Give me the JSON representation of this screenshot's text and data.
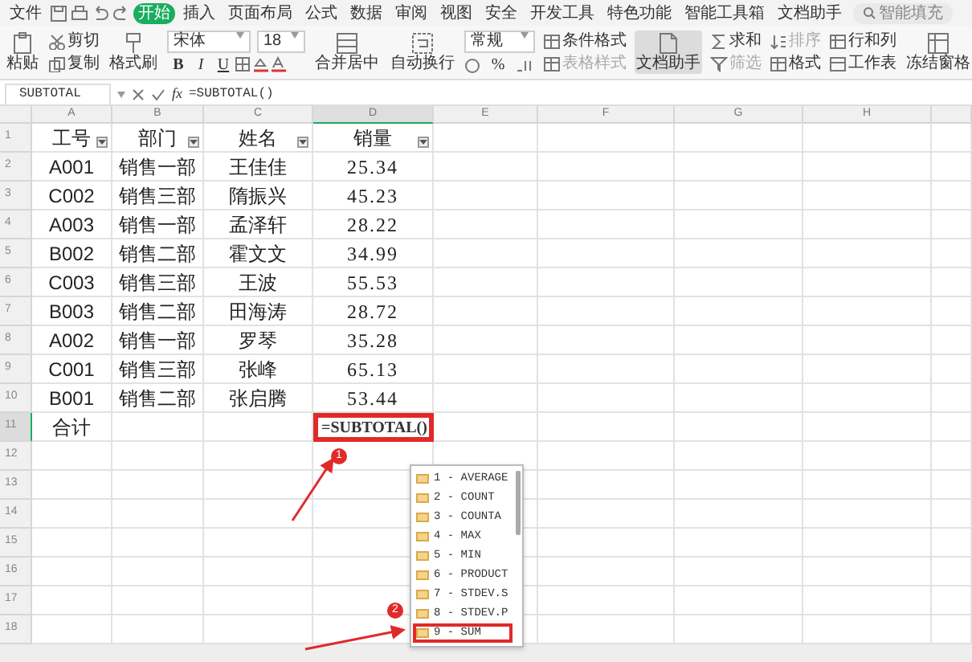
{
  "menu_bar": {
    "file_label": "文件",
    "tabs": [
      {
        "label": "开始",
        "selected": true
      },
      {
        "label": "插入",
        "selected": false
      },
      {
        "label": "页面布局",
        "selected": false
      },
      {
        "label": "公式",
        "selected": false
      },
      {
        "label": "数据",
        "selected": false
      },
      {
        "label": "审阅",
        "selected": false
      },
      {
        "label": "视图",
        "selected": false
      },
      {
        "label": "安全",
        "selected": false
      },
      {
        "label": "开发工具",
        "selected": false
      },
      {
        "label": "特色功能",
        "selected": false
      },
      {
        "label": "智能工具箱",
        "selected": false
      },
      {
        "label": "文档助手",
        "selected": false
      }
    ],
    "search": {
      "placeholder": "智能填充"
    }
  },
  "ribbon": {
    "groups": [
      {
        "kind": "large",
        "items": [
          {
            "label": "粘贴",
            "disabled": false,
            "pressed": false
          }
        ]
      },
      {
        "kind": "stack",
        "items": [
          {
            "label": "剪切",
            "disabled": false,
            "pressed": false
          },
          {
            "label": "复制",
            "disabled": false,
            "pressed": false
          }
        ]
      },
      {
        "kind": "large",
        "items": [
          {
            "label": "格式刷",
            "disabled": false,
            "pressed": false
          }
        ]
      },
      {
        "kind": "font",
        "font": "宋体",
        "size": "18",
        "style_buttons": [
          "B",
          "I",
          "U"
        ]
      },
      {
        "kind": "large",
        "items": [
          {
            "label": "合并居中",
            "disabled": false,
            "pressed": false
          }
        ]
      },
      {
        "kind": "large",
        "items": [
          {
            "label": "自动换行",
            "disabled": false,
            "pressed": false
          }
        ]
      },
      {
        "kind": "number",
        "format": "常规",
        "symbols": [
          "%"
        ]
      },
      {
        "kind": "stack",
        "items": [
          {
            "label": "条件格式",
            "disabled": false,
            "pressed": false
          },
          {
            "label": "表格样式",
            "disabled": true,
            "pressed": false
          }
        ]
      },
      {
        "kind": "large",
        "items": [
          {
            "label": "文档助手",
            "disabled": false,
            "pressed": true
          }
        ]
      },
      {
        "kind": "stack",
        "items": [
          {
            "label": "求和",
            "disabled": false,
            "pressed": false
          },
          {
            "label": "筛选",
            "disabled": true,
            "pressed": false
          }
        ]
      },
      {
        "kind": "stack",
        "items": [
          {
            "label": "排序",
            "disabled": true,
            "pressed": false
          },
          {
            "label": "格式",
            "disabled": false,
            "pressed": false
          }
        ]
      },
      {
        "kind": "stack",
        "items": [
          {
            "label": "行和列",
            "disabled": false,
            "pressed": false
          },
          {
            "label": "工作表",
            "disabled": false,
            "pressed": false
          }
        ]
      },
      {
        "kind": "large",
        "items": [
          {
            "label": "冻结窗格",
            "disabled": false,
            "pressed": false
          }
        ]
      }
    ]
  },
  "formula_bar": {
    "name_box": "SUBTOTAL",
    "function_label": "fx",
    "formula": "=SUBTOTAL()"
  },
  "sheet": {
    "columns": [
      {
        "label": "A",
        "selected": false
      },
      {
        "label": "B",
        "selected": false
      },
      {
        "label": "C",
        "selected": false
      },
      {
        "label": "D",
        "selected": true
      },
      {
        "label": "E",
        "selected": false
      },
      {
        "label": "F",
        "selected": false
      },
      {
        "label": "G",
        "selected": false
      },
      {
        "label": "H",
        "selected": false
      }
    ],
    "rows": [
      {
        "number": "1",
        "selected": false,
        "cells": [
          {
            "text": "工号",
            "filter": true
          },
          {
            "text": "部门",
            "filter": true
          },
          {
            "text": "姓名",
            "filter": true
          },
          {
            "text": "销量",
            "filter": true
          }
        ]
      },
      {
        "number": "2",
        "selected": false,
        "cells": [
          {
            "text": "A001"
          },
          {
            "text": "销售一部"
          },
          {
            "text": "王佳佳"
          },
          {
            "text": "25.34"
          }
        ]
      },
      {
        "number": "3",
        "selected": false,
        "cells": [
          {
            "text": "C002"
          },
          {
            "text": "销售三部"
          },
          {
            "text": "隋振兴"
          },
          {
            "text": "45.23"
          }
        ]
      },
      {
        "number": "4",
        "selected": false,
        "cells": [
          {
            "text": "A003"
          },
          {
            "text": "销售一部"
          },
          {
            "text": "孟泽轩"
          },
          {
            "text": "28.22"
          }
        ]
      },
      {
        "number": "5",
        "selected": false,
        "cells": [
          {
            "text": "B002"
          },
          {
            "text": "销售二部"
          },
          {
            "text": "霍文文"
          },
          {
            "text": "34.99"
          }
        ]
      },
      {
        "number": "6",
        "selected": false,
        "cells": [
          {
            "text": "C003"
          },
          {
            "text": "销售三部"
          },
          {
            "text": "王波"
          },
          {
            "text": "55.53"
          }
        ]
      },
      {
        "number": "7",
        "selected": false,
        "cells": [
          {
            "text": "B003"
          },
          {
            "text": "销售二部"
          },
          {
            "text": "田海涛"
          },
          {
            "text": "28.72"
          }
        ]
      },
      {
        "number": "8",
        "selected": false,
        "cells": [
          {
            "text": "A002"
          },
          {
            "text": "销售一部"
          },
          {
            "text": "罗琴"
          },
          {
            "text": "35.28"
          }
        ]
      },
      {
        "number": "9",
        "selected": false,
        "cells": [
          {
            "text": "C001"
          },
          {
            "text": "销售三部"
          },
          {
            "text": "张峰"
          },
          {
            "text": "65.13"
          }
        ]
      },
      {
        "number": "10",
        "selected": false,
        "cells": [
          {
            "text": "B001"
          },
          {
            "text": "销售二部"
          },
          {
            "text": "张启腾"
          },
          {
            "text": "53.44"
          }
        ]
      },
      {
        "number": "11",
        "selected": true,
        "cells": [
          {
            "text": "合计"
          },
          {
            "text": ""
          },
          {
            "text": ""
          },
          {
            "text": "=SUBTOTAL()",
            "editing": true
          }
        ]
      },
      {
        "number": "12",
        "selected": false,
        "cells": []
      },
      {
        "number": "13",
        "selected": false,
        "cells": []
      },
      {
        "number": "14",
        "selected": false,
        "cells": []
      },
      {
        "number": "15",
        "selected": false,
        "cells": []
      },
      {
        "number": "16",
        "selected": false,
        "cells": []
      },
      {
        "number": "17",
        "selected": false,
        "cells": []
      },
      {
        "number": "18",
        "selected": false,
        "cells": []
      }
    ]
  },
  "autocomplete": {
    "items": [
      {
        "label": "1 - AVERAGE",
        "selected": false
      },
      {
        "label": "2 - COUNT",
        "selected": false
      },
      {
        "label": "3 - COUNTA",
        "selected": false
      },
      {
        "label": "4 - MAX",
        "selected": false
      },
      {
        "label": "5 - MIN",
        "selected": false
      },
      {
        "label": "6 - PRODUCT",
        "selected": false
      },
      {
        "label": "7 - STDEV.S",
        "selected": false
      },
      {
        "label": "8 - STDEV.P",
        "selected": false
      },
      {
        "label": "9 - SUM",
        "selected": true
      }
    ]
  },
  "annotations": [
    {
      "label": "1"
    },
    {
      "label": "2"
    }
  ]
}
